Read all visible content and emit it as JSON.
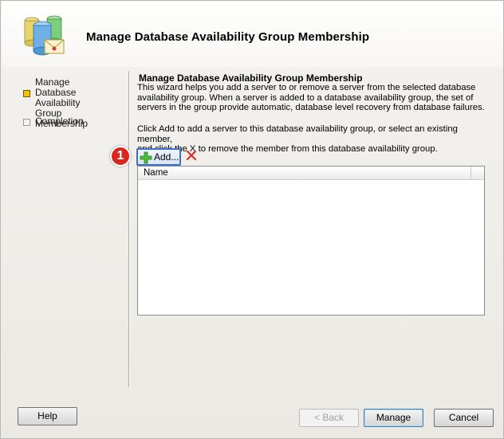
{
  "wizard": {
    "title": "Manage Database Availability Group Membership",
    "icon": "database-group-icon"
  },
  "steps": [
    {
      "lines": [
        "Manage Database",
        "Availability Group",
        "Membership"
      ],
      "state": "current"
    },
    {
      "lines": [
        "Completion"
      ],
      "state": "pending"
    }
  ],
  "main": {
    "section_title": "Manage Database Availability Group Membership",
    "description_lines": [
      "This wizard helps you add a server to or remove a server from the selected database",
      "availability group. When a server is added to a database availability group, the set of",
      "servers in the group provide automatic, database level recovery from database failures."
    ],
    "instruction_lines": [
      "Click Add to add a server to this database availability group, or select an existing member,",
      "and click the X to remove the member from this database availability group."
    ],
    "toolbar": {
      "add_label": "Add...",
      "add_icon": "green-plus-icon",
      "remove_icon": "red-x-icon"
    },
    "callout_number": "1",
    "member_list": {
      "columns": [
        "Name"
      ],
      "rows": []
    }
  },
  "buttons": {
    "help": "Help",
    "back": "< Back",
    "manage": "Manage",
    "cancel": "Cancel"
  },
  "colors": {
    "callout": "#d7261e",
    "add_highlight": "#3f6fc4",
    "current_step": "#f5c400"
  }
}
